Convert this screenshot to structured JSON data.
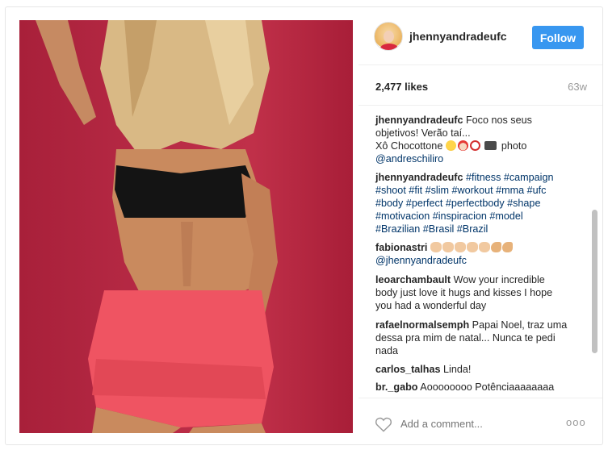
{
  "header": {
    "username": "jhennyandradeufc",
    "follow_label": "Follow"
  },
  "stats": {
    "likes": "2,477 likes",
    "time_ago": "63w"
  },
  "comments": [
    {
      "username": "jhennyandradeufc",
      "line1": " Foco nos seus",
      "line2": "objetivos! Verão taí...",
      "line3_text": "Xô Chocottone ",
      "emojis": [
        "tongue-emoji",
        "santa-emoji",
        "no-entry-emoji",
        "camera-emoji"
      ],
      "line3_end": " photo",
      "mention": "@andreschiliro"
    },
    {
      "username": "jhennyandradeufc",
      "hashtags_line1": " #fitness #campaign",
      "hashtags_line2": "#shoot #fit #slim #workout #mma #ufc",
      "hashtags_line3": "#body #perfect #perfectbody #shape",
      "hashtags_line4": "#motivacion #inspiracion #model",
      "hashtags_line5": "#Brazilian #Brasil #Brazil"
    },
    {
      "username": "fabionastri",
      "emojis": [
        "clap-emoji",
        "clap-emoji",
        "clap-emoji",
        "clap-emoji",
        "clap-emoji",
        "flexed-biceps-emoji",
        "flexed-biceps-emoji"
      ],
      "mention": "@jhennyandradeufc"
    },
    {
      "username": "leoarchambault",
      "line1": " Wow your incredible",
      "line2": "body just love it hugs and kisses I hope",
      "line3": "you had a wonderful day"
    },
    {
      "username": "rafaelnormalsemph",
      "line1": " Papai Noel, traz uma",
      "line2": "dessa pra mim de natal... Nunca te pedi",
      "line3": "nada"
    },
    {
      "username": "carlos_talhas",
      "line1": " Linda!"
    },
    {
      "username": "br._gabo",
      "line1": " Aoooooooo Potênciaaaaaaaa"
    }
  ],
  "footer": {
    "add_comment_placeholder": "Add a comment...",
    "more_label": "ooo"
  },
  "colors": {
    "accent": "#3897f0",
    "hashtag": "#003569",
    "background_photo": "#b72a45"
  }
}
